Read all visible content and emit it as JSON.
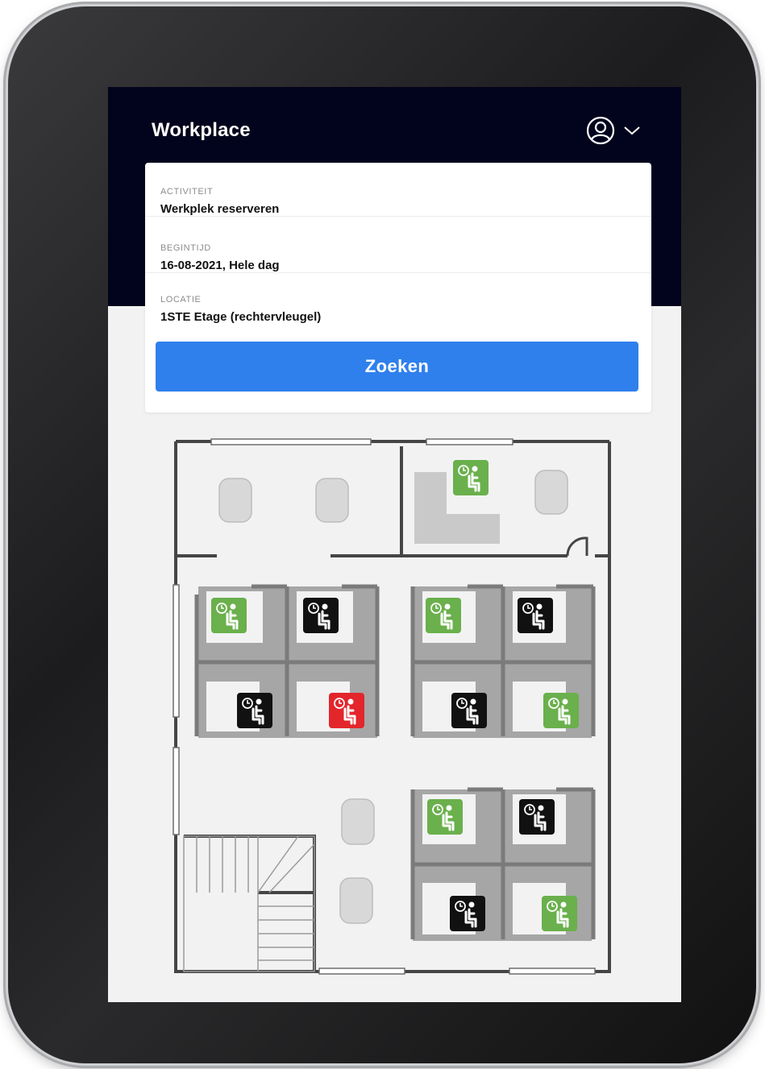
{
  "app": {
    "title": "Workplace"
  },
  "user_menu": {
    "icon": "user-circle-icon",
    "chevron": "chevron-down-icon"
  },
  "search_form": {
    "fields": [
      {
        "label": "ACTIVITEIT",
        "value": "Werkplek reserveren"
      },
      {
        "label": "BEGINTIJD",
        "value": "16-08-2021, Hele dag"
      },
      {
        "label": "LOCATIE",
        "value": "1STE Etage (rechtervleugel)"
      }
    ],
    "search_label": "Zoeken"
  },
  "colors": {
    "header_bg": "#02031c",
    "button": "#2f80ed",
    "available": "#6ab04c",
    "occupied": "#111111",
    "selected": "#e3262b"
  },
  "floorplan": {
    "seats": [
      {
        "id": "office-seat",
        "status": "available"
      },
      {
        "id": "a1",
        "status": "available"
      },
      {
        "id": "a2",
        "status": "occupied"
      },
      {
        "id": "a3",
        "status": "occupied"
      },
      {
        "id": "a4",
        "status": "selected"
      },
      {
        "id": "b1",
        "status": "available"
      },
      {
        "id": "b2",
        "status": "occupied"
      },
      {
        "id": "b3",
        "status": "occupied"
      },
      {
        "id": "b4",
        "status": "available"
      },
      {
        "id": "c1",
        "status": "available"
      },
      {
        "id": "c2",
        "status": "occupied"
      },
      {
        "id": "c3",
        "status": "occupied"
      },
      {
        "id": "c4",
        "status": "available"
      }
    ]
  }
}
